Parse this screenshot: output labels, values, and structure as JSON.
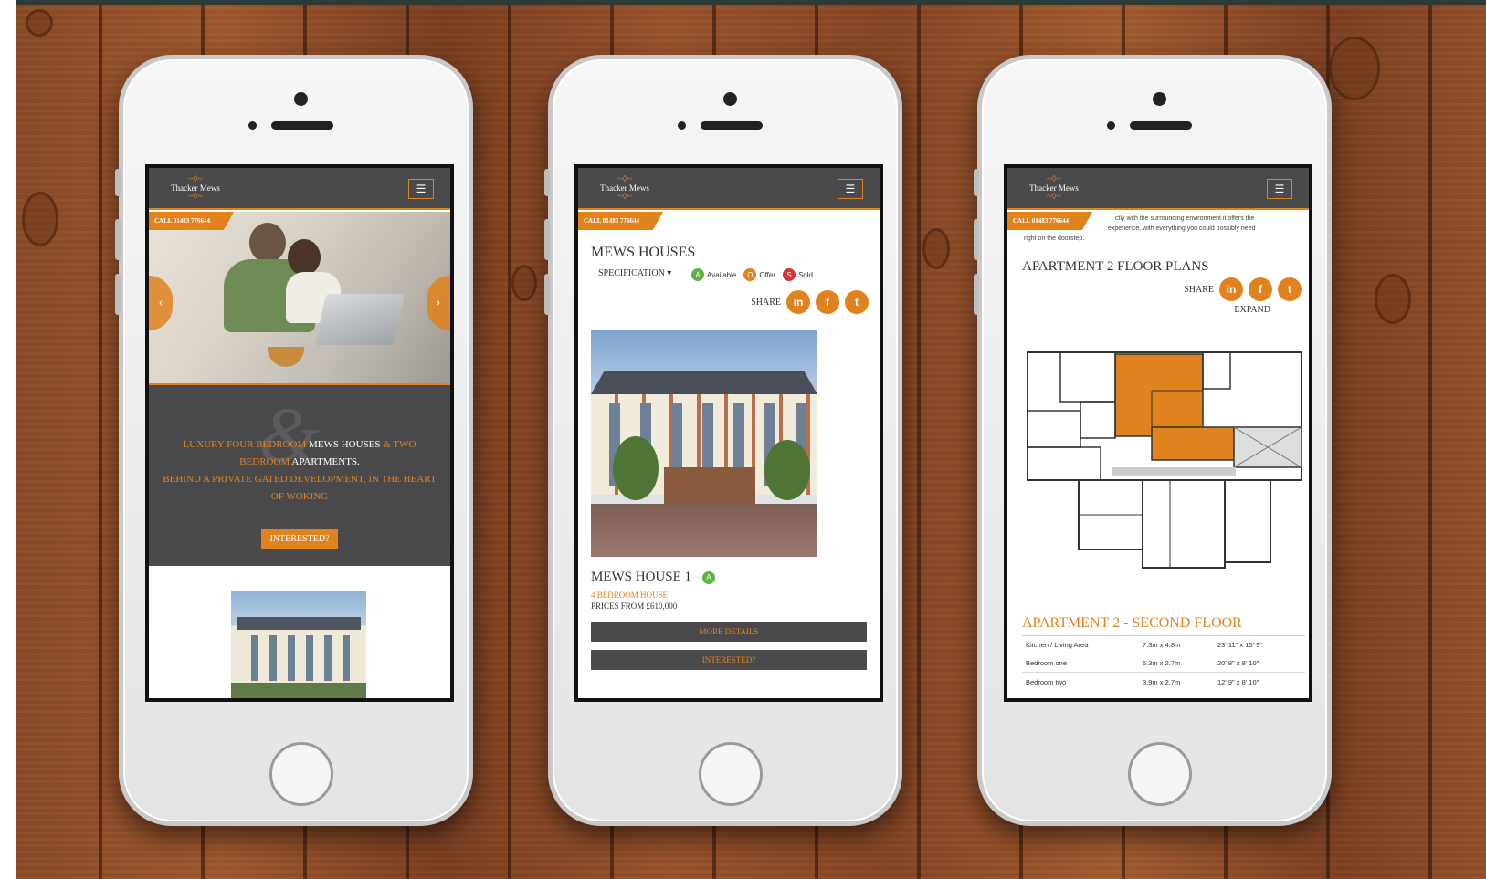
{
  "colors": {
    "accent": "#e0831f",
    "header_bg": "#4a4a4d",
    "available": "#5db346",
    "offer": "#e0831f",
    "sold": "#d83131"
  },
  "phones": [
    {
      "logo": "Thacker Mews",
      "menu_icon": "hamburger-icon",
      "call": "CALL 01483 776644",
      "hero": {
        "headline_orange_1": "LUXURY FOUR BEDROOM",
        "headline_white_1": "MEWS HOUSES",
        "headline_orange_2": "& TWO BEDROOM",
        "headline_white_2": "APARTMENTS",
        "headline_orange_3": "BEHIND A PRIVATE GATED DEVELOPMENT, IN THE HEART OF WOKING",
        "ampersand": "&",
        "cta": "INTERESTED?"
      }
    },
    {
      "logo": "Thacker Mews",
      "menu_icon": "hamburger-icon",
      "call": "CALL 01483 776644",
      "title": "MEWS HOUSES",
      "specification": "SPECIFICATION",
      "legend": [
        {
          "letter": "A",
          "label": "Available"
        },
        {
          "letter": "O",
          "label": "Offer"
        },
        {
          "letter": "S",
          "label": "Sold"
        }
      ],
      "share": "SHARE",
      "social": [
        "in",
        "f",
        "t"
      ],
      "house": {
        "name": "MEWS HOUSE 1",
        "status": "A",
        "type": "4 BEDROOM HOUSE",
        "price": "PRICES FROM £610,000",
        "more": "MORE DETAILS",
        "interested": "INTERESTED?"
      }
    },
    {
      "logo": "Thacker Mews",
      "menu_icon": "hamburger-icon",
      "call": "CALL 01483 776644",
      "intro_line_1": "ctly with the surrounding environment it offers the",
      "intro_line_2": "experience, with everything you could possibly need",
      "intro_line_3": "right on the doorstep.",
      "title": "APARTMENT 2 FLOOR PLANS",
      "share": "SHARE",
      "social": [
        "in",
        "f",
        "t"
      ],
      "expand": "EXPAND",
      "floor_title": "APARTMENT 2 - SECOND FLOOR",
      "rooms": [
        {
          "name": "Kitchen / Living Area",
          "metric": "7.3m x 4.8m",
          "imperial": "23' 11\" x 15' 9\""
        },
        {
          "name": "Bedroom one",
          "metric": "6.3m x 2.7m",
          "imperial": "20' 8\" x 8' 10\""
        },
        {
          "name": "Bedroom two",
          "metric": "3.9m x 2.7m",
          "imperial": "12' 9\" x 8' 10\""
        }
      ]
    }
  ]
}
